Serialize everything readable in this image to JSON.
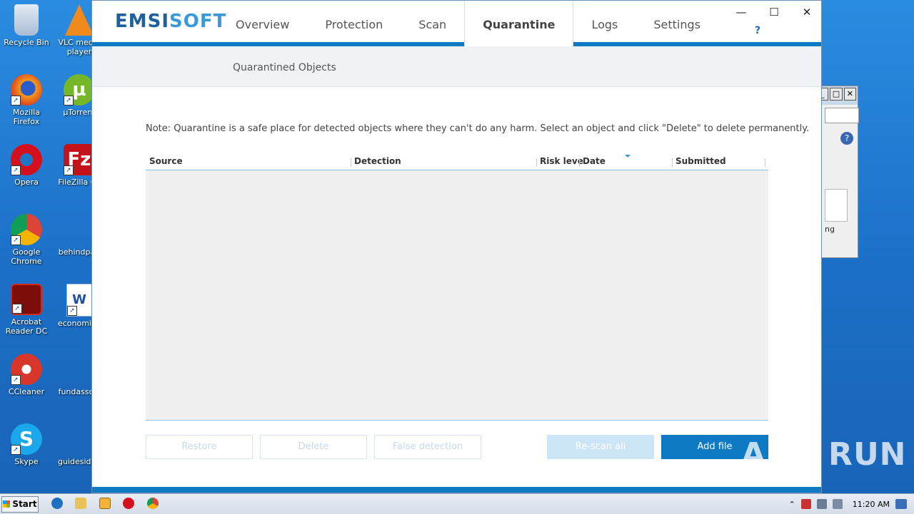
{
  "desktop": {
    "icons": [
      {
        "label": "Recycle Bin",
        "icon": "recycle-bin-icon",
        "color": "#c9d6e6"
      },
      {
        "label": "VLC media player",
        "icon": "vlc-icon",
        "color": "#f08a1c"
      },
      {
        "label": "Mozilla Firefox",
        "icon": "firefox-icon",
        "color": "#e8641c"
      },
      {
        "label": "µTorrent",
        "icon": "utorrent-icon",
        "color": "#76b729"
      },
      {
        "label": "Opera",
        "icon": "opera-icon",
        "color": "#d3101c"
      },
      {
        "label": "FileZilla Cli",
        "icon": "filezilla-icon",
        "color": "#c4121b"
      },
      {
        "label": "Google Chrome",
        "icon": "chrome-icon",
        "color": "#4a8cf0"
      },
      {
        "label": "behindpau",
        "icon": "document-icon",
        "color": "#2a86dc"
      },
      {
        "label": "Acrobat Reader DC",
        "icon": "acrobat-icon",
        "color": "#b1130e"
      },
      {
        "label": "economicg",
        "icon": "word-document-icon",
        "color": "#e8eef8"
      },
      {
        "label": "CCleaner",
        "icon": "ccleaner-icon",
        "color": "#d9362b"
      },
      {
        "label": "fundassoci",
        "icon": "document-icon",
        "color": "#2a86dc"
      },
      {
        "label": "Skype",
        "icon": "skype-icon",
        "color": "#1aa7ec"
      },
      {
        "label": "guidesidea",
        "icon": "document-icon",
        "color": "#2a86dc"
      }
    ],
    "bg_window_text": "ng"
  },
  "app": {
    "logo_left": "EMSI",
    "logo_right": "SOFT",
    "tabs": [
      "Overview",
      "Protection",
      "Scan",
      "Quarantine",
      "Logs",
      "Settings"
    ],
    "active_tab": "Quarantine",
    "help_label": "?",
    "window_controls": {
      "minimize": "—",
      "maximize": "☐",
      "close": "✕"
    },
    "subheader": "Quarantined Objects",
    "note": "Note: Quarantine is a safe place for detected objects where they can't do any harm. Select an object and click \"Delete\" to delete permanently.",
    "columns": [
      "Source",
      "Detection",
      "Risk leve",
      "Date",
      "Submitted"
    ],
    "buttons": {
      "restore": "Restore",
      "delete": "Delete",
      "false_detection": "False detection",
      "rescan_all": "Re-scan all",
      "add_file": "Add file"
    },
    "accent": "#0e7ac4"
  },
  "watermark": "ANY RUN",
  "taskbar": {
    "start_label": "Start",
    "clock": "11:20 AM"
  }
}
